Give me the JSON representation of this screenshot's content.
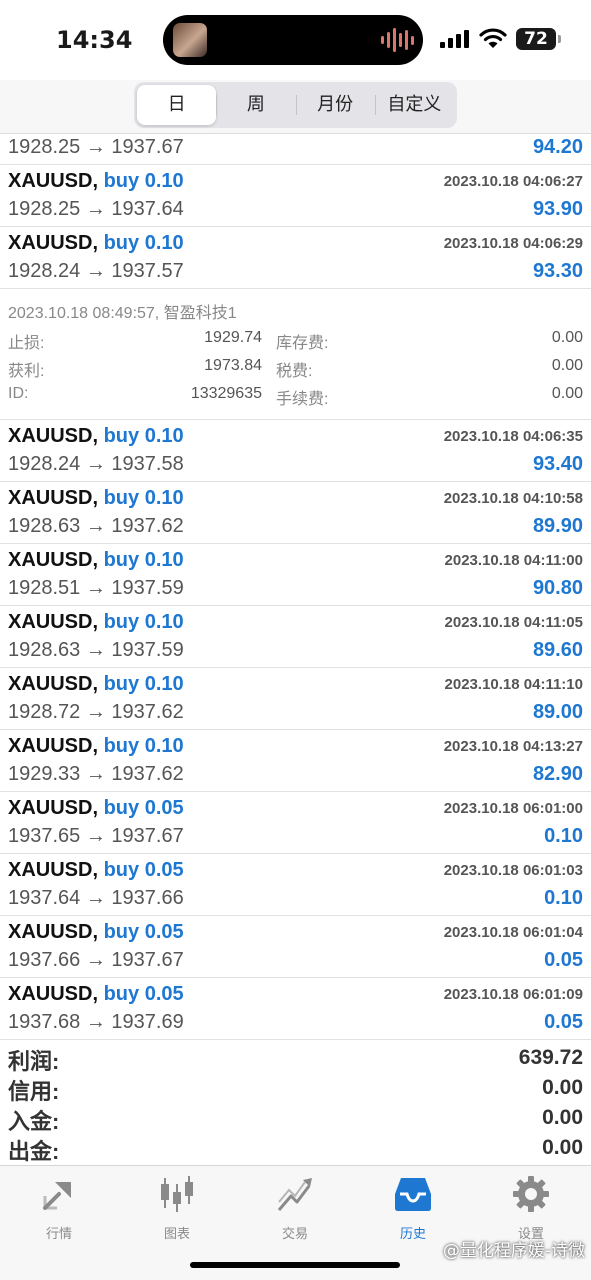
{
  "status_bar": {
    "time": "14:34",
    "battery": "72"
  },
  "segments": [
    {
      "label": "日",
      "active": true
    },
    {
      "label": "周",
      "active": false
    },
    {
      "label": "月份",
      "active": false
    },
    {
      "label": "自定义",
      "active": false
    }
  ],
  "partial_deal": {
    "prices": "1928.25 → 1937.67",
    "profit": "94.20"
  },
  "deals_top": [
    {
      "symbol": "XAUUSD,",
      "side": "buy 0.10",
      "datetime": "2023.10.18 04:06:27",
      "prices": "1928.25 → 1937.64",
      "profit": "93.90"
    },
    {
      "symbol": "XAUUSD,",
      "side": "buy 0.10",
      "datetime": "2023.10.18 04:06:29",
      "prices": "1928.24 → 1937.57",
      "profit": "93.30"
    }
  ],
  "detail": {
    "header": "2023.10.18 08:49:57, 智盈科技1",
    "rows": [
      {
        "label1": "止损:",
        "value1": "1929.74",
        "label2": "库存费:",
        "value2": "0.00"
      },
      {
        "label1": "获利:",
        "value1": "1973.84",
        "label2": "税费:",
        "value2": "0.00"
      },
      {
        "label1": "ID:",
        "value1": "13329635",
        "label2": "手续费:",
        "value2": "0.00"
      }
    ]
  },
  "deals_bottom": [
    {
      "symbol": "XAUUSD,",
      "side": "buy 0.10",
      "datetime": "2023.10.18 04:06:35",
      "prices": "1928.24 → 1937.58",
      "profit": "93.40"
    },
    {
      "symbol": "XAUUSD,",
      "side": "buy 0.10",
      "datetime": "2023.10.18 04:10:58",
      "prices": "1928.63 → 1937.62",
      "profit": "89.90"
    },
    {
      "symbol": "XAUUSD,",
      "side": "buy 0.10",
      "datetime": "2023.10.18 04:11:00",
      "prices": "1928.51 → 1937.59",
      "profit": "90.80"
    },
    {
      "symbol": "XAUUSD,",
      "side": "buy 0.10",
      "datetime": "2023.10.18 04:11:05",
      "prices": "1928.63 → 1937.59",
      "profit": "89.60"
    },
    {
      "symbol": "XAUUSD,",
      "side": "buy 0.10",
      "datetime": "2023.10.18 04:11:10",
      "prices": "1928.72 → 1937.62",
      "profit": "89.00"
    },
    {
      "symbol": "XAUUSD,",
      "side": "buy 0.10",
      "datetime": "2023.10.18 04:13:27",
      "prices": "1929.33 → 1937.62",
      "profit": "82.90"
    },
    {
      "symbol": "XAUUSD,",
      "side": "buy 0.05",
      "datetime": "2023.10.18 06:01:00",
      "prices": "1937.65 → 1937.67",
      "profit": "0.10"
    },
    {
      "symbol": "XAUUSD,",
      "side": "buy 0.05",
      "datetime": "2023.10.18 06:01:03",
      "prices": "1937.64 → 1937.66",
      "profit": "0.10"
    },
    {
      "symbol": "XAUUSD,",
      "side": "buy 0.05",
      "datetime": "2023.10.18 06:01:04",
      "prices": "1937.66 → 1937.67",
      "profit": "0.05"
    },
    {
      "symbol": "XAUUSD,",
      "side": "buy 0.05",
      "datetime": "2023.10.18 06:01:09",
      "prices": "1937.68 → 1937.69",
      "profit": "0.05"
    }
  ],
  "totals": [
    {
      "label": "利润:",
      "value": "639.72"
    },
    {
      "label": "信用:",
      "value": "0.00"
    },
    {
      "label": "入金:",
      "value": "0.00"
    },
    {
      "label": "出金:",
      "value": "0.00"
    }
  ],
  "tabs": [
    {
      "label": "行情",
      "icon": "quotes-icon",
      "active": false
    },
    {
      "label": "图表",
      "icon": "chart-icon",
      "active": false
    },
    {
      "label": "交易",
      "icon": "trade-icon",
      "active": false
    },
    {
      "label": "历史",
      "icon": "history-icon",
      "active": true
    },
    {
      "label": "设置",
      "icon": "settings-icon",
      "active": false
    }
  ],
  "watermark": "@量化程序媛-诗微",
  "colors": {
    "accent": "#1e78d2",
    "inactive": "#8a8a8a"
  }
}
